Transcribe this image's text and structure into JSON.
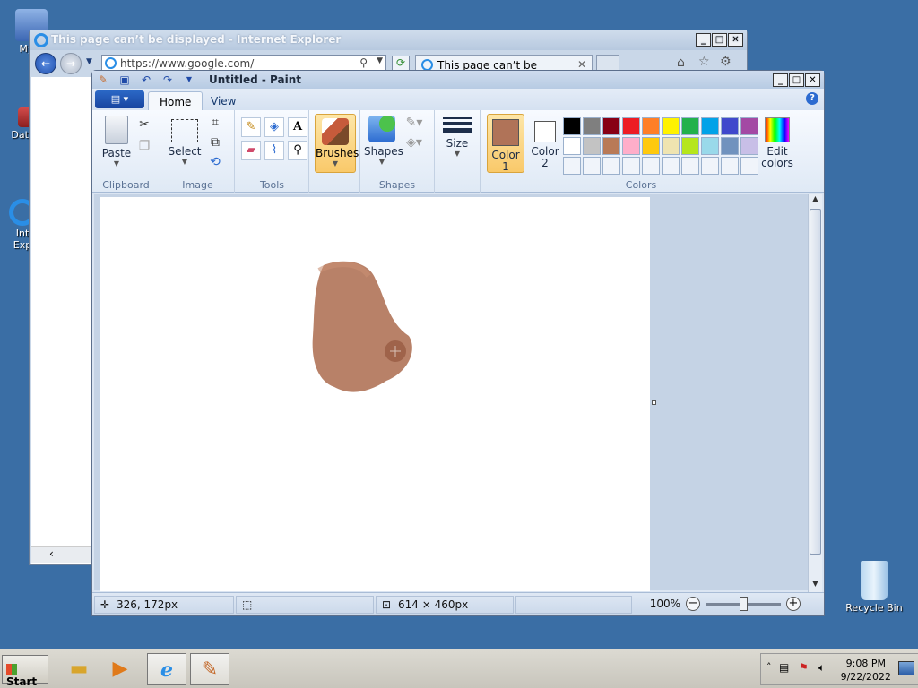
{
  "desktop": {
    "icons": [
      {
        "label": "My C",
        "icon": "computer-icon"
      },
      {
        "label": "DataW",
        "icon": "shortcut-icon"
      },
      {
        "label": "Int Exp",
        "icon": "ie-icon"
      },
      {
        "label": "Recycle Bin",
        "icon": "recycle-bin-icon"
      }
    ]
  },
  "ie": {
    "title": "This page can’t be displayed - Internet Explorer",
    "address": "https://www.google.com/",
    "tab_label": "This page can’t be displayed",
    "tab_close": "✕"
  },
  "paint": {
    "title": "Untitled - Paint",
    "tabs": [
      "Home",
      "View"
    ],
    "groups": {
      "clipboard": {
        "label": "Clipboard",
        "paste": "Paste"
      },
      "image": {
        "label": "Image",
        "select": "Select"
      },
      "tools": {
        "label": "Tools"
      },
      "brushes": {
        "label": "Brushes"
      },
      "shapes": {
        "label": "Shapes",
        "button": "Shapes"
      },
      "size": {
        "label": "Size"
      },
      "colors": {
        "label": "Colors",
        "color1": "Color",
        "color1_n": "1",
        "color2": "Color",
        "color2_n": "2",
        "edit": "Edit",
        "edit2": "colors",
        "color1_value": "#b07358",
        "color2_value": "#ffffff",
        "palette": [
          "#000000",
          "#7f7f7f",
          "#880015",
          "#ed1c24",
          "#ff7f27",
          "#fff200",
          "#22b14c",
          "#00a2e8",
          "#3f48cc",
          "#a349a4",
          "#ffffff",
          "#c3c3c3",
          "#b97a57",
          "#ffaec9",
          "#ffc90e",
          "#efe4b0",
          "#b5e61d",
          "#99d9ea",
          "#7092be",
          "#c8bfe7",
          "#f0f4fa",
          "#f0f4fa",
          "#f0f4fa",
          "#f0f4fa",
          "#f0f4fa",
          "#f0f4fa",
          "#f0f4fa",
          "#f0f4fa",
          "#f0f4fa",
          "#f0f4fa"
        ]
      }
    },
    "status": {
      "cursor_pos": "326, 172px",
      "canvas_size": "614 × 460px",
      "zoom": "100%",
      "zoom_minus": "−",
      "zoom_plus": "+"
    }
  },
  "taskbar": {
    "start": "Start",
    "time": "9:08 PM",
    "date": "9/22/2022"
  }
}
